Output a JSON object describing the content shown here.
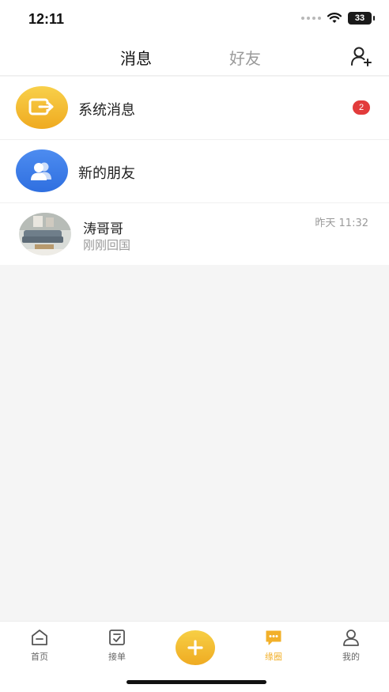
{
  "status_bar": {
    "time": "12:11",
    "battery": "33"
  },
  "header": {
    "tabs": [
      {
        "label": "消息",
        "active": true
      },
      {
        "label": "好友",
        "active": false
      }
    ],
    "add_friend_icon": "add-user-icon"
  },
  "list": {
    "system": {
      "title": "系统消息",
      "badge": "2",
      "icon": "system-message-icon",
      "color": "#f2b02a"
    },
    "new_friends": {
      "title": "新的朋友",
      "icon": "friends-icon",
      "color": "#3a78e8"
    },
    "chats": [
      {
        "name": "涛哥哥",
        "preview": "刚刚回国",
        "time": "昨天 11:32"
      }
    ]
  },
  "tab_bar": {
    "items": [
      {
        "label": "首页",
        "icon": "home-icon"
      },
      {
        "label": "接单",
        "icon": "orders-icon"
      },
      {
        "label": "",
        "icon": "plus-icon"
      },
      {
        "label": "缘圈",
        "icon": "chat-bubble-icon",
        "active": true
      },
      {
        "label": "我的",
        "icon": "user-icon"
      }
    ],
    "accent": "#f2b02a"
  }
}
